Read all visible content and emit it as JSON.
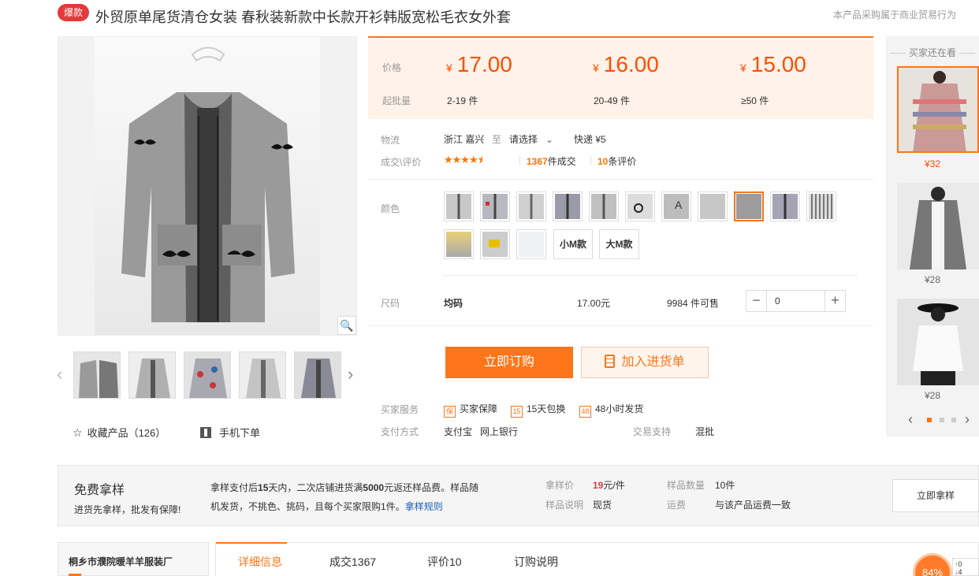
{
  "header": {
    "badge": "爆款",
    "title": "外贸原单尾货清仓女装 春秋装新款中长款开衫韩版宽松毛衣女外套",
    "notice": "本产品采购属于商业贸易行为"
  },
  "gallery": {
    "actions": {
      "favorite": "收藏产品（126）",
      "mobile": "手机下单"
    }
  },
  "price_table": {
    "price_label": "价格",
    "moq_label": "起批量",
    "currency": "¥",
    "tiers": [
      {
        "price": "17.00",
        "range": "2-19 件"
      },
      {
        "price": "16.00",
        "range": "20-49 件"
      },
      {
        "price": "15.00",
        "range": "≥50 件"
      }
    ]
  },
  "logistics": {
    "label": "物流",
    "from": "浙江 嘉兴",
    "to_word": "至",
    "select": "请选择",
    "express": "快递 ¥5"
  },
  "deals": {
    "label": "成交\\评价",
    "rating": 4.5,
    "deals_count": "1367",
    "deals_suffix": "件成交",
    "review_count": "10",
    "review_suffix": "条评价"
  },
  "color": {
    "label": "颜色",
    "text_options": [
      "小M款",
      "大M款"
    ],
    "selected_index": 8
  },
  "size": {
    "label": "尺码",
    "name": "均码",
    "price": "17.00元",
    "stock": "9984 件可售",
    "quantity": "0"
  },
  "buttons": {
    "buy": "立即订购",
    "cart": "加入进货单"
  },
  "service": {
    "label": "买家服务",
    "items": [
      {
        "icon": "保",
        "text": "买家保障"
      },
      {
        "icon": "15",
        "text": "15天包换"
      },
      {
        "icon": "48",
        "text": "48小时发货"
      }
    ]
  },
  "payment": {
    "label": "支付方式",
    "methods": "支付宝   网上银行",
    "trade_label": "交易支持",
    "trade_value": "混批"
  },
  "rail": {
    "title": "买家还在看",
    "items": [
      {
        "price": "¥32"
      },
      {
        "price": "¥28"
      },
      {
        "price": "¥28"
      }
    ]
  },
  "sample": {
    "title": "免费拿样",
    "subtitle": "进货先拿样，批发有保障!",
    "desc_1a": "拿样支付后",
    "desc_1b": "15",
    "desc_1c": "天内，二次店铺进货满",
    "desc_1d": "5000",
    "desc_1e": "元返还样品费。样品随",
    "desc_2": "机发货，不挑色、挑码，且每个买家限购1件。",
    "rule_link": "拿样规则",
    "price_label": "拿样价",
    "price_value": "19",
    "price_unit": "元/件",
    "desc_label": "样品说明",
    "desc_value": "现货",
    "qty_label": "样品数量",
    "qty_value": "10件",
    "fee_label": "运费",
    "fee_value": "与该产品运费一致",
    "button": "立即拿样"
  },
  "bottom": {
    "shop_name": "桐乡市濮院暖羊羊服装厂",
    "tabs": [
      "详细信息",
      "成交1367",
      "评价10",
      "订购说明"
    ],
    "progress": "84%"
  }
}
